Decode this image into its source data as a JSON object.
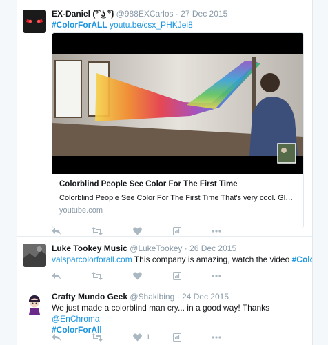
{
  "tweets": [
    {
      "name": "EX-Daniel (͡° ͜ʖ ͡°)",
      "handle": "@988EXCarlos",
      "sep": "·",
      "date": "27 Dec 2015",
      "hashtag": "#ColorForALL",
      "link": "youtu.be/csx_PHKJei8",
      "card": {
        "title": "Colorblind People See Color For The First Time",
        "description": "Colorblind People See Color For The First Time That's very cool. Glasses, Glasses, Glasses",
        "domain": "youtube.com"
      }
    },
    {
      "name": "Luke Tookey Music",
      "handle": "@LukeTookey",
      "sep": "·",
      "date": "26 Dec 2015",
      "link": "valsparcolorforall.com",
      "text": " This company is amazing, watch the video ",
      "hashtag": "#ColorForAll"
    },
    {
      "name": "Crafty Mundo Geek",
      "handle": "@Shakibing",
      "sep": "·",
      "date": "24 Dec 2015",
      "text": "We just made a colorblind man cry... in a good way! Thanks ",
      "mention": "@EnChroma",
      "hashtag": "#ColorForAll",
      "like_count": "1"
    }
  ],
  "colors": {
    "link": "#1b95e0",
    "icon": "#aab8c2",
    "meta": "#8899a6"
  },
  "action_icons": [
    "reply-icon",
    "retweet-icon",
    "like-icon",
    "analytics-icon",
    "more-icon"
  ]
}
